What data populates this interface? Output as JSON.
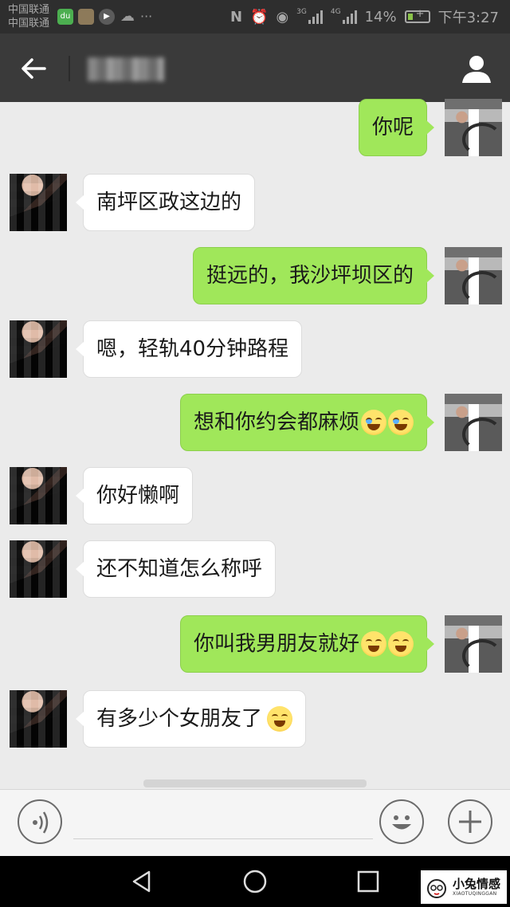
{
  "status_bar": {
    "carrier_1": "中国联通",
    "carrier_2": "中国联通",
    "app_icons": [
      "du",
      "img",
      "play",
      "cloud"
    ],
    "more": "···",
    "network": "3G",
    "network_2": "4G",
    "battery_percent": "14%",
    "time": "下午3:27"
  },
  "header": {
    "back_icon": "arrow-left-icon",
    "title_obscured": true,
    "profile_icon": "user-icon"
  },
  "messages": [
    {
      "side": "out",
      "text": "你呢"
    },
    {
      "side": "in",
      "text": "南坪区政这边的"
    },
    {
      "side": "out",
      "text": "挺远的，我沙坪坝区的"
    },
    {
      "side": "in",
      "text": "嗯，轻轨40分钟路程"
    },
    {
      "side": "out",
      "text": "想和你约会都麻烦",
      "emoji": [
        "laughing-tears",
        "laughing-tears"
      ]
    },
    {
      "side": "in",
      "text": "你好懒啊"
    },
    {
      "side": "in",
      "text": "还不知道怎么称呼"
    },
    {
      "side": "out",
      "text": "你叫我男朋友就好",
      "emoji": [
        "goofy",
        "goofy"
      ]
    },
    {
      "side": "in",
      "text": "有多少个女朋友了",
      "emoji": [
        "grin"
      ]
    }
  ],
  "input_bar": {
    "voice_icon": "voice-icon",
    "input_value": "",
    "emoji_icon": "smiley-icon",
    "plus_icon": "plus-icon"
  },
  "nav_bar": {
    "back": "nav-back-icon",
    "home": "nav-home-icon",
    "recent": "nav-recent-icon"
  },
  "watermark": {
    "name": "小兔情感",
    "sub": "XIAOTUQINGGAN"
  },
  "colors": {
    "outgoing": "#a0e75a",
    "incoming": "#ffffff",
    "header": "#3a3a3a",
    "background": "#ebebeb"
  }
}
